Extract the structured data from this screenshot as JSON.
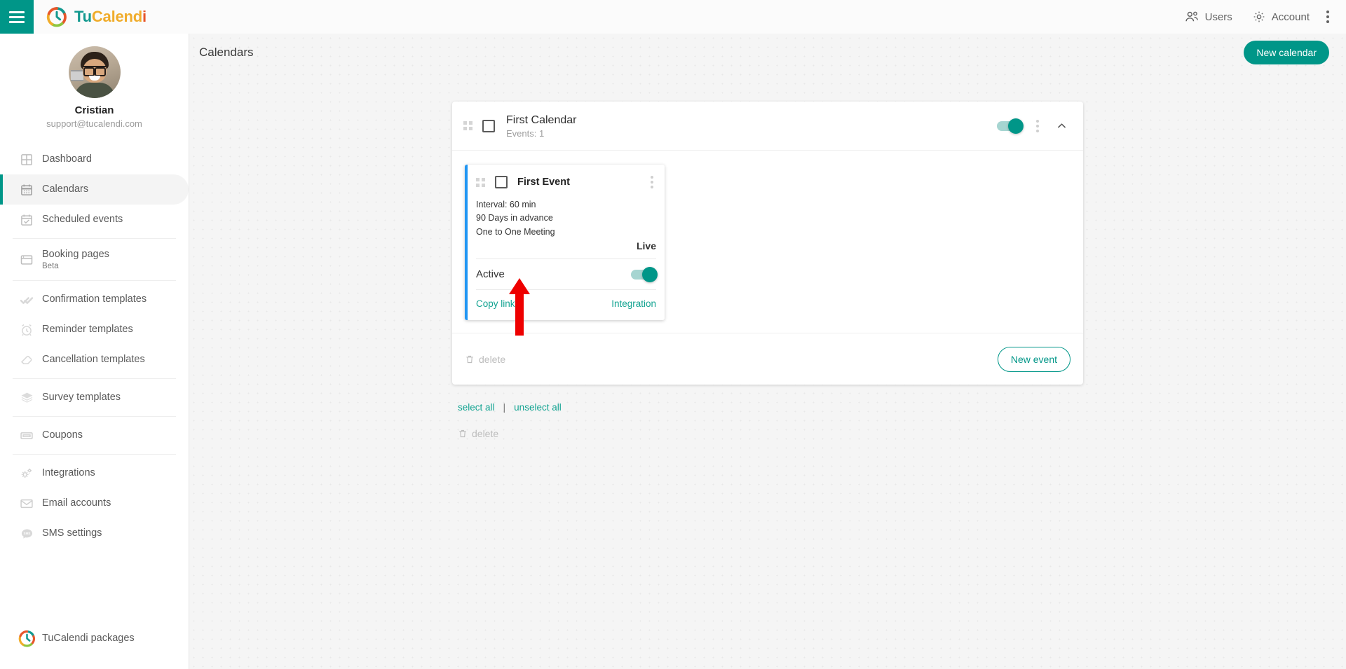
{
  "topbar": {
    "menu_icon": "hamburger-icon",
    "brand": {
      "part1": "Tu",
      "part2": "Calend",
      "part3": "i",
      "logo_icon": "tucalendi-logo-icon"
    },
    "users_label": "Users",
    "users_icon": "users-icon",
    "account_label": "Account",
    "account_icon": "gear-icon",
    "overflow_icon": "vertical-dots-icon"
  },
  "sidebar": {
    "profile": {
      "name": "Cristian",
      "email": "support@tucalendi.com",
      "avatar_icon": "user-avatar-photo"
    },
    "items": [
      {
        "label": "Dashboard",
        "icon": "dashboard-grid-icon",
        "active": false
      },
      {
        "label": "Calendars",
        "icon": "calendar-icon",
        "active": true
      },
      {
        "label": "Scheduled events",
        "icon": "calendar-check-icon",
        "active": false
      },
      {
        "label": "Booking pages",
        "sub": "Beta",
        "icon": "window-icon",
        "active": false
      },
      {
        "label": "Confirmation templates",
        "icon": "double-check-icon",
        "active": false
      },
      {
        "label": "Reminder templates",
        "icon": "alarm-clock-icon",
        "active": false
      },
      {
        "label": "Cancellation templates",
        "icon": "eraser-icon",
        "active": false
      },
      {
        "label": "Survey templates",
        "icon": "layers-icon",
        "active": false
      },
      {
        "label": "Coupons",
        "icon": "ticket-icon",
        "active": false
      },
      {
        "label": "Integrations",
        "icon": "gears-icon",
        "active": false
      },
      {
        "label": "Email accounts",
        "icon": "envelope-icon",
        "active": false
      },
      {
        "label": "SMS settings",
        "icon": "sms-bubble-icon",
        "active": false
      }
    ],
    "footer": {
      "label": "TuCalendi packages",
      "icon": "tucalendi-logo-icon"
    }
  },
  "main": {
    "page_title": "Calendars",
    "new_calendar_label": "New calendar",
    "calendar": {
      "name": "First Calendar",
      "events_count_label": "Events: 1",
      "drag_handle_icon": "drag-dots-icon",
      "checkbox_icon": "checkbox-unchecked-icon",
      "toggle_state": "on",
      "overflow_icon": "vertical-dots-icon",
      "collapse_icon": "chevron-up-icon",
      "delete_label": "delete",
      "delete_icon": "trash-icon",
      "new_event_label": "New event",
      "event": {
        "name": "First Event",
        "drag_handle_icon": "drag-dots-icon",
        "checkbox_icon": "checkbox-unchecked-icon",
        "overflow_icon": "vertical-dots-icon",
        "meta": [
          "Interval: 60 min",
          "90 Days in advance",
          "One to One Meeting"
        ],
        "status_label": "Live",
        "active_label": "Active",
        "active_toggle_state": "on",
        "copy_link_label": "Copy link",
        "integration_label": "Integration",
        "accent_bar_color": "#2196f3"
      }
    },
    "bulk": {
      "select_all_label": "select all",
      "separator": "|",
      "unselect_all_label": "unselect all",
      "delete_label": "delete",
      "delete_icon": "trash-icon"
    }
  },
  "annotation": {
    "arrow_icon": "red-up-arrow-icon",
    "color": "#ee0000",
    "points_at": "Copy link"
  },
  "colors": {
    "accent_teal": "#009688",
    "link_teal": "#12a391",
    "event_blue": "#2196f3",
    "annotation_red": "#ee0000",
    "content_bg": "#f5f5f5"
  }
}
